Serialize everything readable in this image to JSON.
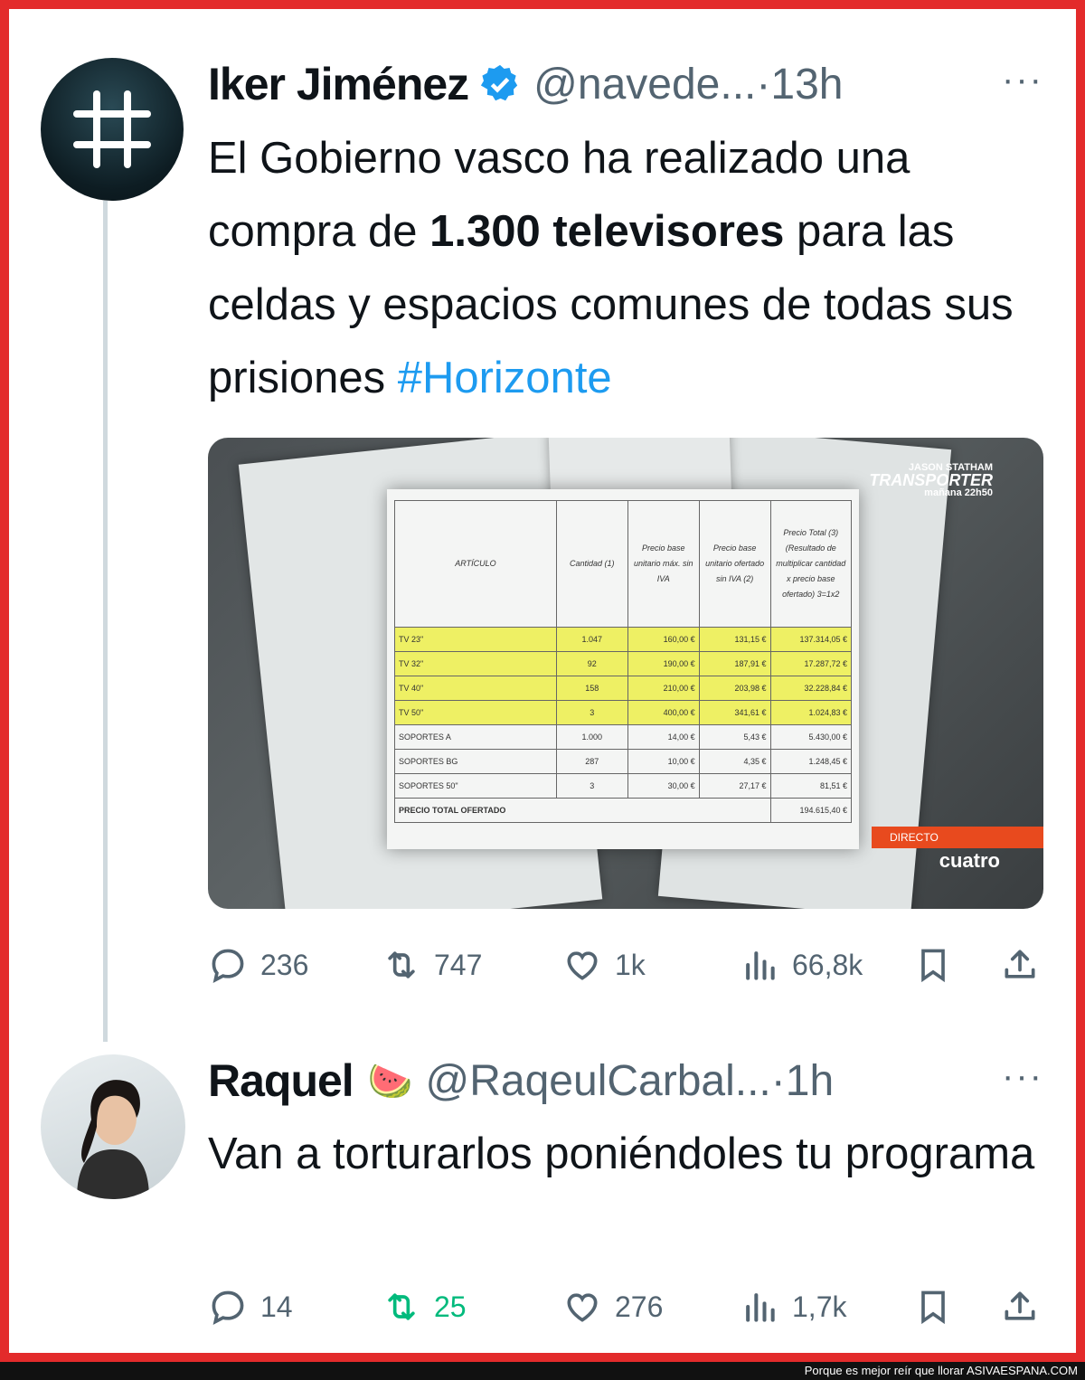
{
  "tweet1": {
    "name": "Iker Jiménez",
    "handle": "@navede...",
    "time": "·13h",
    "more": "···",
    "verified_icon": "verified-badge",
    "text_before": "El Gobierno vasco ha realizado una compra de ",
    "text_bold": "1.300 televisores",
    "text_after": " para las celdas y espacios comunes de todas sus prisiones ",
    "hashtag": "#Horizonte",
    "media": {
      "table_headers": [
        "ARTÍCULO",
        "Cantidad (1)",
        "Precio base unitario máx. sin IVA",
        "Precio base unitario ofertado sin IVA (2)",
        "Precio Total (3) (Resultado de multiplicar cantidad x precio base ofertado) 3=1x2"
      ],
      "rows": [
        {
          "item": "TV 23\"",
          "qty": "1.047",
          "max": "160,00 €",
          "offer": "131,15 €",
          "total": "137.314,05 €",
          "highlight": true
        },
        {
          "item": "TV 32\"",
          "qty": "92",
          "max": "190,00 €",
          "offer": "187,91 €",
          "total": "17.287,72 €",
          "highlight": true
        },
        {
          "item": "TV 40\"",
          "qty": "158",
          "max": "210,00 €",
          "offer": "203,98 €",
          "total": "32.228,84 €",
          "highlight": true
        },
        {
          "item": "TV 50\"",
          "qty": "3",
          "max": "400,00 €",
          "offer": "341,61 €",
          "total": "1.024,83 €",
          "highlight": true
        },
        {
          "item": "SOPORTES A",
          "qty": "1.000",
          "max": "14,00 €",
          "offer": "5,43 €",
          "total": "5.430,00 €",
          "highlight": false
        },
        {
          "item": "SOPORTES BG",
          "qty": "287",
          "max": "10,00 €",
          "offer": "4,35 €",
          "total": "1.248,45 €",
          "highlight": false
        },
        {
          "item": "SOPORTES 50\"",
          "qty": "3",
          "max": "30,00 €",
          "offer": "27,17 €",
          "total": "81,51 €",
          "highlight": false
        }
      ],
      "total_label": "PRECIO TOTAL OFERTADO",
      "total_value": "194.615,40 €",
      "tv_line1": "JASON STATHAM",
      "tv_line2": "TRANSPORTER",
      "tv_line3": "mañana 22h50",
      "directo": "DIRECTO",
      "channel": "cuatro"
    },
    "actions": {
      "replies": "236",
      "retweets": "747",
      "likes": "1k",
      "views": "66,8k"
    }
  },
  "tweet2": {
    "name": "Raquel",
    "emoji": "🍉",
    "handle": "@RaqeulCarbal...",
    "time": "·1h",
    "more": "···",
    "text": "Van a torturarlos poniéndoles tu programa",
    "actions": {
      "replies": "14",
      "retweets": "25",
      "likes": "276",
      "views": "1,7k"
    }
  },
  "footer": {
    "caption": "Porque es mejor reír que llorar ",
    "site": "ASIVAESPANA.COM"
  },
  "colors": {
    "border": "#e32b2b",
    "hashtag": "#1d9bf0",
    "retweet_active": "#00ba7c",
    "muted": "#536471"
  }
}
